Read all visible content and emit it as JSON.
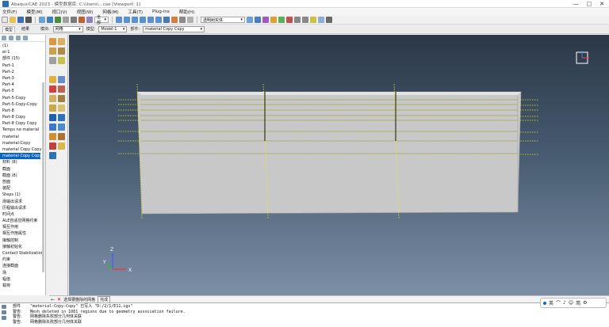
{
  "window": {
    "title": "Abaqus/CAE 2023 - 模型数据库: C:\\Users\\...cae [Viewport: 1]",
    "buttons": [
      "—",
      "□",
      "✕"
    ]
  },
  "menu": [
    "文件(F)",
    "模型(M)",
    "视口(V)",
    "视图(W)",
    "网格(M)",
    "工具(T)",
    "Plug-ins",
    "帮助(H)"
  ],
  "toolbar": {
    "zoom_select": "全部",
    "view_select": "透明树实体"
  },
  "context": {
    "tabs": [
      "模型",
      "结果"
    ],
    "active_tab": "模型",
    "module_label": "模块:",
    "module_value": "网格",
    "model_label": "模型:",
    "model_value": "Model-1",
    "part_label": "部件:",
    "part_value": "material Copy Copy"
  },
  "tree": {
    "items": [
      {
        "label": "(1)"
      },
      {
        "label": "el-1"
      },
      {
        "label": "部件 (15)"
      },
      {
        "label": "Part-1"
      },
      {
        "label": "Part-2"
      },
      {
        "label": "Part-3"
      },
      {
        "label": "Part-4"
      },
      {
        "label": "Part-5"
      },
      {
        "label": "Part-5-Copy"
      },
      {
        "label": "Part-5-Copy-Copy"
      },
      {
        "label": "Part-8"
      },
      {
        "label": "Part-8 Copy"
      },
      {
        "label": "Part-8 Copy Copy"
      },
      {
        "label": "Temps no material"
      },
      {
        "label": "material"
      },
      {
        "label": "material-Copy"
      },
      {
        "label": "material Copy Copy"
      },
      {
        "label": "material Copy Copy",
        "selected": true
      },
      {
        "label": "材料 (8)"
      },
      {
        "label": "截面"
      },
      {
        "label": "截面 (8)"
      },
      {
        "label": "剖面"
      },
      {
        "label": "装配"
      },
      {
        "label": "Steps (1)"
      },
      {
        "label": "场输出请求"
      },
      {
        "label": "历程输出请求"
      },
      {
        "label": "时间点"
      },
      {
        "label": "ALE自适应网格约束"
      },
      {
        "label": "相互作用"
      },
      {
        "label": "相互作用属性"
      },
      {
        "label": "接触控制"
      },
      {
        "label": "接触初始化"
      },
      {
        "label": "Contact Stabilization"
      },
      {
        "label": "约束"
      },
      {
        "label": "连接截面"
      },
      {
        "label": "场"
      },
      {
        "label": "幅值"
      },
      {
        "label": "载荷"
      }
    ]
  },
  "viewport": {
    "triad_axes": [
      "X",
      "Y",
      "Z"
    ],
    "gradient_top": "#2c3847",
    "gradient_bottom": "#7c8fa6",
    "mesh_seed_color": "#e8e820",
    "part_color": "#c8c8c8",
    "panel_count": 3,
    "seeded_edges_horizontal": 7,
    "seeded_edges_vertical": 3
  },
  "prompt": {
    "text": "选择要删除的网格",
    "done_label": "完成"
  },
  "messages": {
    "labels": [
      "部件",
      "警告:",
      "警告:",
      "警告:"
    ],
    "lines": [
      "\"material-Copy-Copy\" 已写入 \"D:/2/1/E11.igs\"",
      "Mesh deleted in 1081 regions due to geometry association failure.",
      "网格删除失败部分几何体关联",
      "网格删除失败部分几何体关联"
    ]
  },
  "ime": {
    "items": [
      "英",
      "⌒",
      "♪",
      "☺",
      "简",
      "⚙"
    ]
  }
}
